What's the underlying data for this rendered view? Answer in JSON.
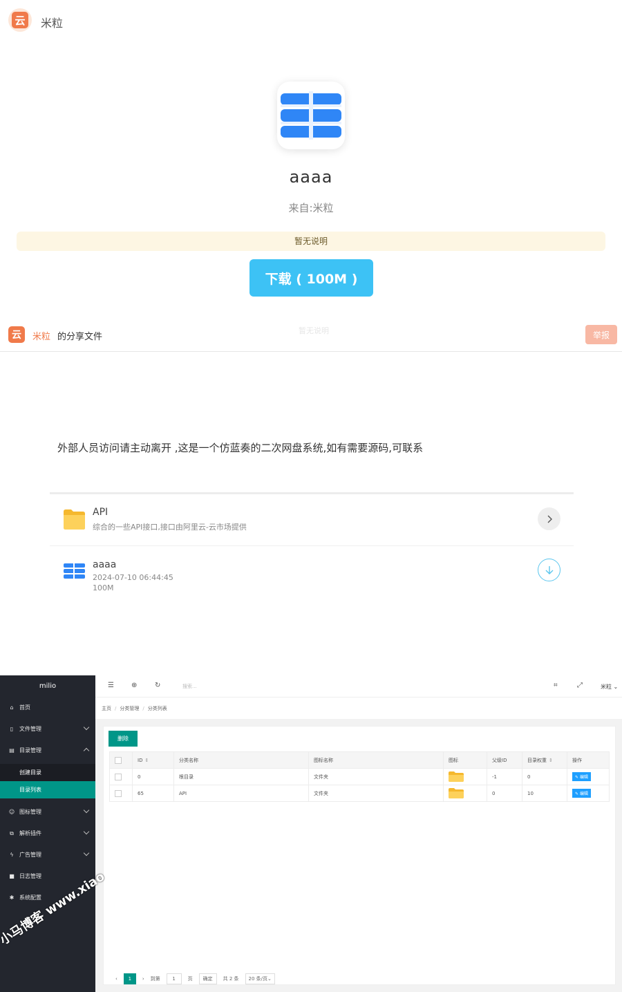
{
  "download_page": {
    "logo_char": "云",
    "brand": "米粒",
    "file_name": "aaaa",
    "source": "来自:米粒",
    "description": "暂无说明",
    "download_label": "下载 ( 100M )"
  },
  "share_page": {
    "logo_char": "云",
    "username": "米粒",
    "share_suffix": "的分享文件",
    "faint_text": "暂无说明",
    "report_label": "举报",
    "announcement": "外部人员访问请主动离开 ,这是一个仿蓝奏的二次网盘系统,如有需要源码,可联系",
    "items": [
      {
        "title": "API",
        "subtitle": "综合的一些API接口,接口由阿里云-云市场提供"
      },
      {
        "title": "aaaa",
        "date": "2024-07-10 06:44:45",
        "size": "100M"
      }
    ]
  },
  "admin": {
    "brand": "milio",
    "menu": [
      {
        "label": "首页",
        "icon": "home-icon"
      },
      {
        "label": "文件管理",
        "icon": "file-icon"
      },
      {
        "label": "目录管理",
        "icon": "folder-manage-icon"
      },
      {
        "label": "创建目录"
      },
      {
        "label": "目录列表"
      },
      {
        "label": "图标管理",
        "icon": "smile-icon"
      },
      {
        "label": "解析插件",
        "icon": "plugin-icon"
      },
      {
        "label": "广告管理",
        "icon": "ad-icon"
      },
      {
        "label": "日志管理",
        "icon": "log-icon"
      },
      {
        "label": "系统配置",
        "icon": "gear-icon"
      }
    ],
    "search_placeholder": "搜索...",
    "user": "米粒",
    "breadcrumb": [
      "主页",
      "分类管理",
      "分类列表"
    ],
    "delete_label": "删除",
    "columns": [
      "ID",
      "分类名称",
      "图标名称",
      "图标",
      "父级ID",
      "目录权重",
      "操作"
    ],
    "rows": [
      {
        "id": "0",
        "name": "根目录",
        "icon_name": "文件夹",
        "parent": "-1",
        "weight": "0",
        "action": "编辑"
      },
      {
        "id": "65",
        "name": "API",
        "icon_name": "文件夹",
        "parent": "0",
        "weight": "10",
        "action": "编辑"
      }
    ],
    "pager": {
      "current": "1",
      "goto_label": "到第",
      "page_input": "1",
      "page_unit": "页",
      "confirm": "确定",
      "total": "共 2 条",
      "per_page": "20 条/页"
    }
  },
  "watermark": "小马博客 www.xiao",
  "colors": {
    "accent_teal": "#009688",
    "download_blue": "#3dc2f5",
    "brand_orange": "#f07a4a",
    "edit_blue": "#1e9fff"
  }
}
